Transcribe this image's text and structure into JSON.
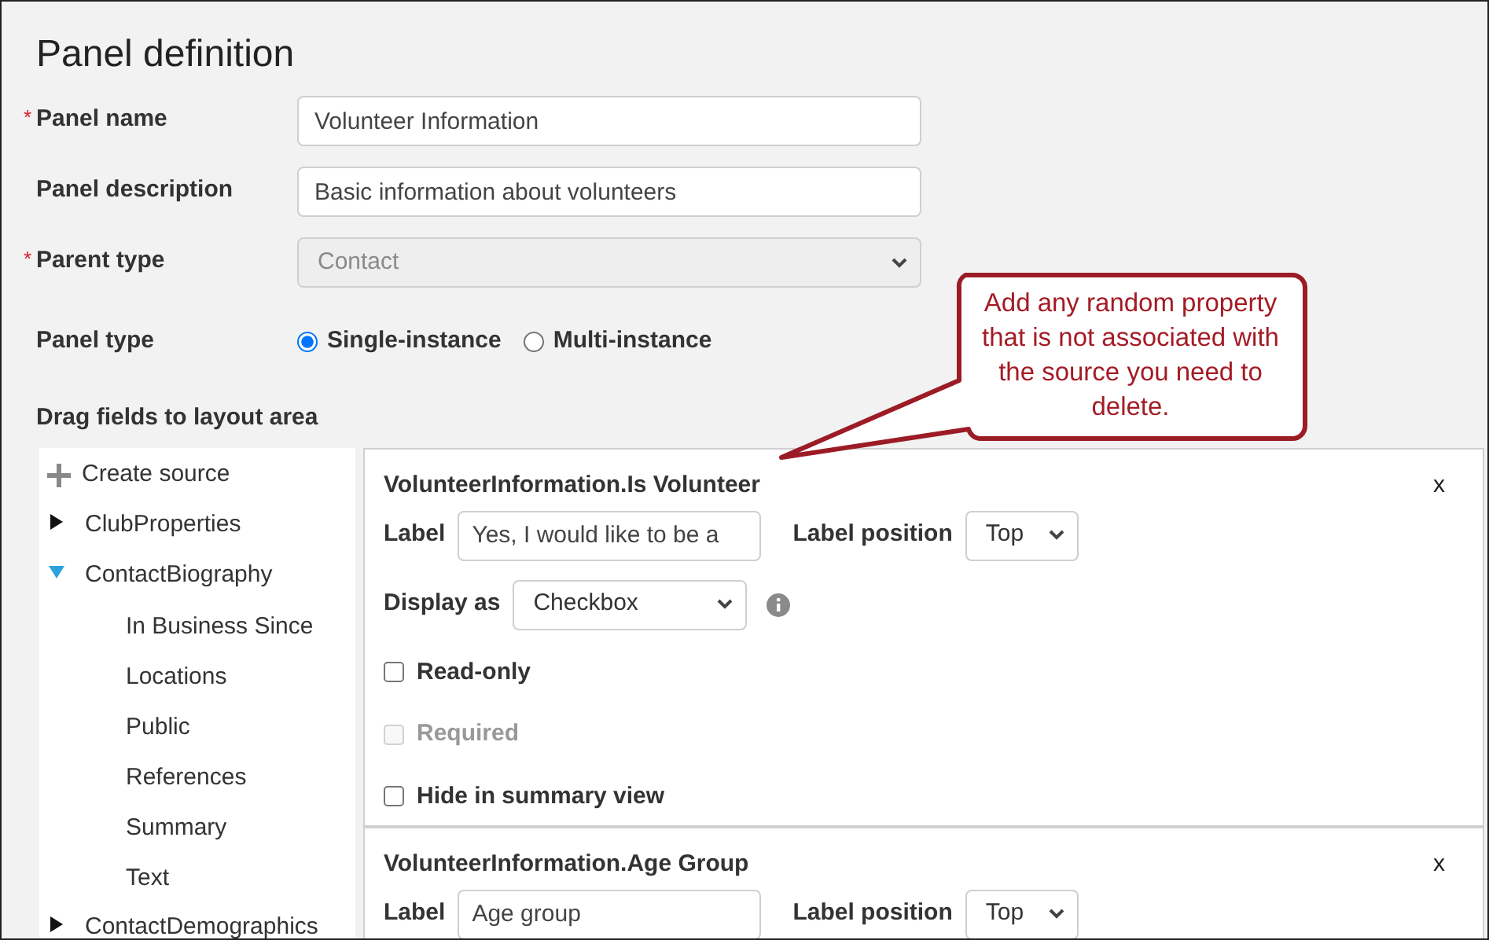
{
  "title": "Panel definition",
  "fields": [
    {
      "kind": "text",
      "marker": "*",
      "label": "Panel name",
      "value": "Volunteer Information"
    },
    {
      "kind": "text",
      "label": "Panel description",
      "value": "Basic information about volunteers"
    },
    {
      "kind": "select",
      "marker": "*",
      "label": "Parent type",
      "value": "Contact",
      "disabled": true
    }
  ],
  "panel_type": {
    "label": "Panel type",
    "options": [
      {
        "label": "Single-instance",
        "selected": true
      },
      {
        "label": "Multi-instance",
        "selected": false
      }
    ]
  },
  "drag_label": "Drag fields to layout area",
  "tree": [
    {
      "kind": "action",
      "label": "Create source"
    },
    {
      "kind": "node",
      "label": "ClubProperties",
      "expanded": false
    },
    {
      "kind": "node",
      "label": "ContactBiography",
      "expanded": true,
      "children": [
        {
          "label": "In Business Since"
        },
        {
          "label": "Locations"
        },
        {
          "label": "Public"
        },
        {
          "label": "References"
        },
        {
          "label": "Summary"
        },
        {
          "label": "Text"
        }
      ]
    },
    {
      "kind": "node",
      "label": "ContactDemographics",
      "expanded": false
    }
  ],
  "cards": [
    {
      "title": "VolunteerInformation.Is Volunteer",
      "close": "x",
      "label": "Label",
      "label_value": "Yes, I would like to be a",
      "position_label": "Label position",
      "position_value": "Top",
      "display_label": "Display as",
      "display_value": "Checkbox",
      "checkboxes": [
        {
          "label": "Read-only",
          "checked": false,
          "disabled": false
        },
        {
          "label": "Required",
          "checked": false,
          "disabled": true
        },
        {
          "label": "Hide in summary view",
          "checked": false,
          "disabled": false
        }
      ]
    },
    {
      "title": "VolunteerInformation.Age Group",
      "close": "x",
      "label": "Label",
      "label_value": "Age group",
      "position_label": "Label position",
      "position_value": "Top"
    }
  ],
  "callout": "Add any random property that is not associated with the source you need to delete."
}
